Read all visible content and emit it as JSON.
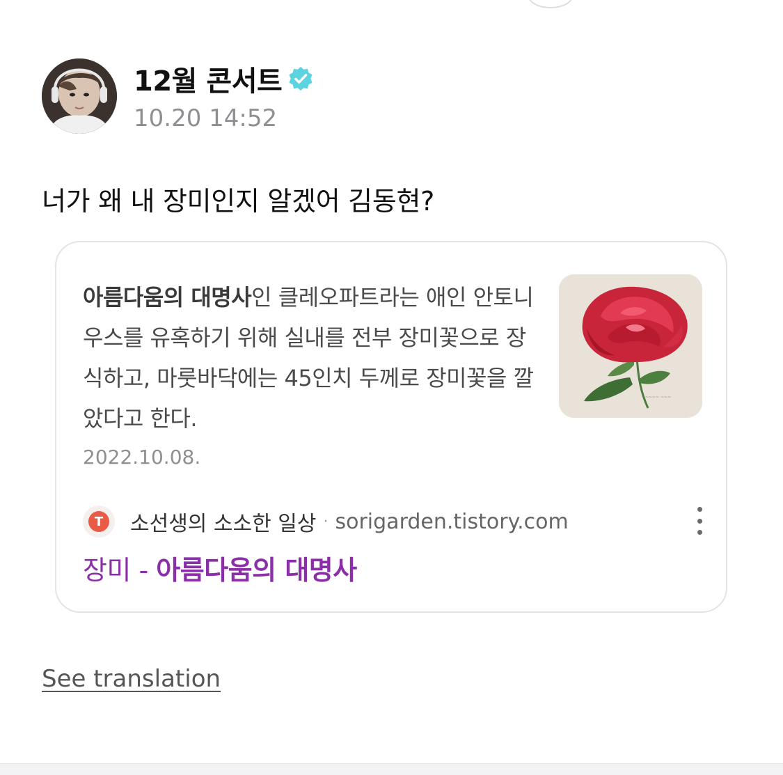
{
  "post": {
    "author_name": "12월 콘서트",
    "timestamp": "10.20 14:52",
    "text": "너가 왜 내 장미인지 알겠어 김동현?"
  },
  "card": {
    "snippet_bold": "아름다움의 대명사",
    "snippet_rest": "인 클레오파트라는 애인 안토니우스를 유혹하기 위해 실내를 전부 장미꽃으로 장식하고, 마룻바닥에는 45인치 두께로 장미꽃을 깔았다고 한다.",
    "date": "2022.10.08.",
    "source_name": "소선생의 소소한 일상",
    "source_separator": "·",
    "source_domain": "sorigarden.tistory.com",
    "title_prefix": "장미 - ",
    "title_bold": "아름다움의 대명사",
    "colors": {
      "title": "#8a2fa8",
      "source_logo": "#ea5b45"
    }
  },
  "footer": {
    "see_translation": "See translation"
  },
  "icons": {
    "verified": "verified-badge-icon",
    "more": "more-vertical-icon",
    "source": "tistory-logo-icon"
  },
  "colors": {
    "verified": "#5dd3e0"
  }
}
